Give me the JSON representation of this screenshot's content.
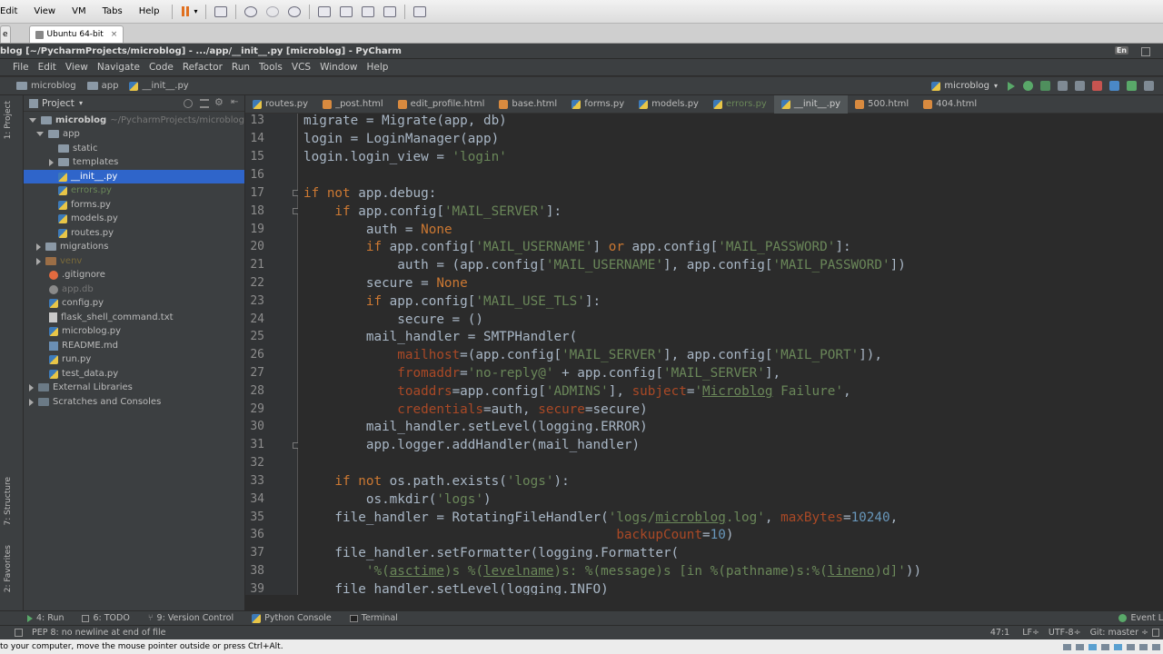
{
  "vm_menu": [
    "Edit",
    "View",
    "VM",
    "Tabs",
    "Help"
  ],
  "vm_tabs": {
    "first": "e",
    "active": "Ubuntu 64-bit"
  },
  "ide_title": "blog [~/PycharmProjects/microblog] - .../app/__init__.py [microblog] - PyCharm",
  "ide_menu": [
    "File",
    "Edit",
    "View",
    "Navigate",
    "Code",
    "Refactor",
    "Run",
    "Tools",
    "VCS",
    "Window",
    "Help"
  ],
  "breadcrumb": [
    "microblog",
    "app",
    "__init__.py"
  ],
  "run_config": "microblog",
  "project": {
    "title": "Project",
    "root": "microblog",
    "root_path": "~/PycharmProjects/microblog",
    "items": [
      {
        "label": "app",
        "kind": "folder"
      },
      {
        "label": "static",
        "kind": "folder"
      },
      {
        "label": "templates",
        "kind": "folder"
      },
      {
        "label": "__init__.py",
        "kind": "py"
      },
      {
        "label": "errors.py",
        "kind": "py"
      },
      {
        "label": "forms.py",
        "kind": "py"
      },
      {
        "label": "models.py",
        "kind": "py"
      },
      {
        "label": "routes.py",
        "kind": "py"
      },
      {
        "label": "migrations",
        "kind": "folder"
      },
      {
        "label": "venv",
        "kind": "folder"
      },
      {
        "label": ".gitignore",
        "kind": "git"
      },
      {
        "label": "app.db",
        "kind": "db"
      },
      {
        "label": "config.py",
        "kind": "py"
      },
      {
        "label": "flask_shell_command.txt",
        "kind": "txt"
      },
      {
        "label": "microblog.py",
        "kind": "py"
      },
      {
        "label": "README.md",
        "kind": "md"
      },
      {
        "label": "run.py",
        "kind": "py"
      },
      {
        "label": "test_data.py",
        "kind": "py"
      },
      {
        "label": "External Libraries",
        "kind": "lib"
      },
      {
        "label": "Scratches and Consoles",
        "kind": "lib"
      }
    ]
  },
  "editor_tabs": [
    "routes.py",
    "_post.html",
    "edit_profile.html",
    "base.html",
    "forms.py",
    "models.py",
    "errors.py",
    "__init__.py",
    "500.html",
    "404.html"
  ],
  "left_tool_tabs": {
    "project": "1: Project",
    "structure": "7: Structure",
    "favorites": "2: Favorites"
  },
  "code_line_numbers": [
    "13",
    "14",
    "15",
    "16",
    "17",
    "18",
    "19",
    "20",
    "21",
    "22",
    "23",
    "24",
    "25",
    "26",
    "27",
    "28",
    "29",
    "30",
    "31",
    "32",
    "33",
    "34",
    "35",
    "36",
    "37",
    "38",
    "39"
  ],
  "code": {
    "l13": "migrate = Migrate(app, db)",
    "l14": "login = LoginManager(app)",
    "l15a": "login.login_view = ",
    "l15b": "'login'",
    "l17a": "if not",
    "l17b": " app.debug:",
    "l18a": "    if",
    "l18b": " app.config[",
    "l18c": "'MAIL_SERVER'",
    "l18d": "]:",
    "l19a": "        auth = ",
    "l19b": "None",
    "l20a": "        if",
    "l20b": " app.config[",
    "l20c": "'MAIL_USERNAME'",
    "l20d": "] ",
    "l20e": "or",
    "l20f": " app.config[",
    "l20g": "'MAIL_PASSWORD'",
    "l20h": "]:",
    "l21a": "            auth = (app.config[",
    "l21b": "'MAIL_USERNAME'",
    "l21c": "], app.config[",
    "l21d": "'MAIL_PASSWORD'",
    "l21e": "])",
    "l22a": "        secure = ",
    "l22b": "None",
    "l23a": "        if",
    "l23b": " app.config[",
    "l23c": "'MAIL_USE_TLS'",
    "l23d": "]:",
    "l24": "            secure = ()",
    "l25": "        mail_handler = SMTPHandler(",
    "l26a": "            ",
    "l26b": "mailhost",
    "l26c": "=(app.config[",
    "l26d": "'MAIL_SERVER'",
    "l26e": "], app.config[",
    "l26f": "'MAIL_PORT'",
    "l26g": "]),",
    "l27a": "            ",
    "l27b": "fromaddr",
    "l27c": "=",
    "l27d": "'no-reply@'",
    "l27e": " + app.config[",
    "l27f": "'MAIL_SERVER'",
    "l27g": "],",
    "l28a": "            ",
    "l28b": "toaddrs",
    "l28c": "=app.config[",
    "l28d": "'ADMINS'",
    "l28e": "], ",
    "l28f": "subject",
    "l28g": "=",
    "l28h": "'",
    "l28i": "Microblog",
    "l28j": " Failure'",
    "l28k": ",",
    "l29a": "            ",
    "l29b": "credentials",
    "l29c": "=auth, ",
    "l29d": "secure",
    "l29e": "=secure)",
    "l30": "        mail_handler.setLevel(logging.ERROR)",
    "l31": "        app.logger.addHandler(mail_handler)",
    "l33a": "    if not",
    "l33b": " os.path.exists(",
    "l33c": "'logs'",
    "l33d": "):",
    "l34a": "        os.mkdir(",
    "l34b": "'logs'",
    "l34c": ")",
    "l35a": "    file_handler = RotatingFileHandler(",
    "l35b": "'logs/",
    "l35c": "microblog",
    "l35d": ".log'",
    "l35e": ", ",
    "l35f": "maxBytes",
    "l35g": "=",
    "l35h": "10240",
    "l35i": ",",
    "l36a": "                                        ",
    "l36b": "backupCount",
    "l36c": "=",
    "l36d": "10",
    "l36e": ")",
    "l37": "    file_handler.setFormatter(logging.Formatter(",
    "l38a": "        ",
    "l38b": "'%(",
    "l38c": "asctime",
    "l38d": ")s %(",
    "l38e": "levelname",
    "l38f": ")s: %(message)s [in %(pathname)s:%(",
    "l38g": "lineno",
    "l38h": ")d]'",
    "l38i": "))",
    "l39": "    file_handler.setLevel(logging.INFO)"
  },
  "tool_windows": [
    "4: Run",
    "6: TODO",
    "9: Version Control",
    "Python Console",
    "Terminal",
    "Event L"
  ],
  "status": {
    "message": "PEP 8: no newline at end of file",
    "position": "47:1",
    "line_sep": "LF÷",
    "encoding": "UTF-8÷",
    "git": "Git: master ÷"
  },
  "vm_hint": "to your computer, move the mouse pointer outside or press Ctrl+Alt.",
  "colors": {
    "selection": "#2f65ca",
    "keyword": "#cc7832",
    "string": "#6a8759",
    "number": "#6897bb",
    "param": "#aa4926"
  }
}
